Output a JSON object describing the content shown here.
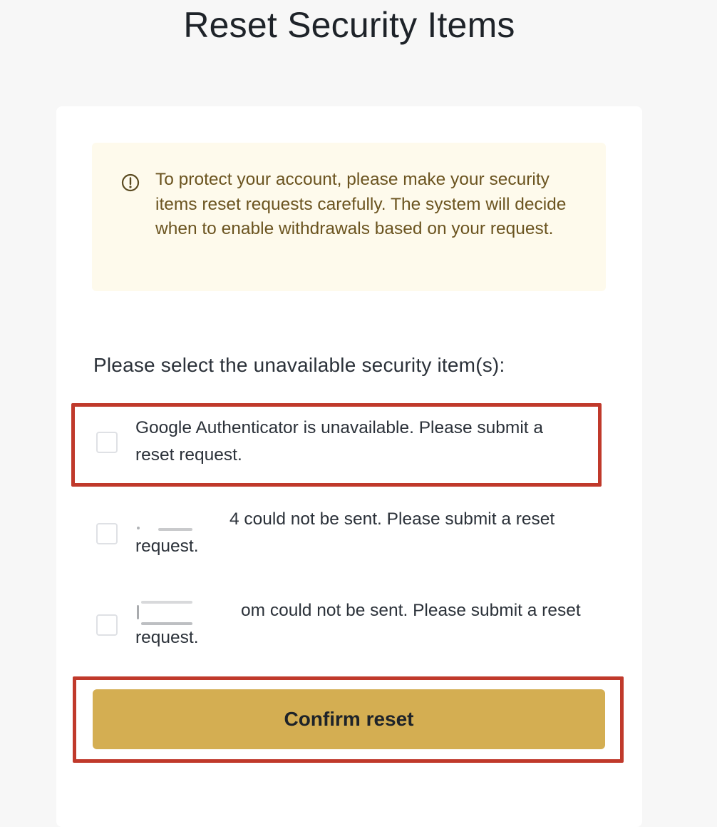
{
  "page": {
    "title": "Reset Security Items"
  },
  "notice": {
    "icon": "info-circle-icon",
    "text": "To protect your account, please make your security items reset requests carefully. The system will decide when to enable withdrawals based on your request."
  },
  "form": {
    "section_label": "Please select the unavailable security item(s):",
    "options": [
      {
        "label": "Google Authenticator is unavailable. Please submit a reset request.",
        "checked": false
      },
      {
        "label": "4 could not be sent. Please submit a reset request.",
        "checked": false
      },
      {
        "label": "om could not be sent. Please submit a reset request.",
        "checked": false
      }
    ],
    "confirm_label": "Confirm reset"
  },
  "colors": {
    "background": "#f7f7f7",
    "notice_background": "#fefaec",
    "notice_text": "#6b5420",
    "button_accent": "#d4ae52",
    "highlight_border": "#c0392b"
  }
}
